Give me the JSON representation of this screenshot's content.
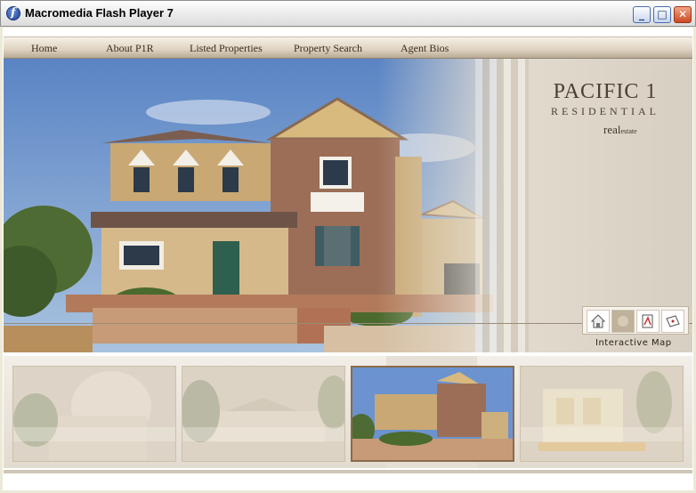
{
  "window": {
    "title": "Macromedia Flash Player 7",
    "icon": "flash-player-icon",
    "controls": {
      "minimize": "minimize-icon",
      "maximize": "maximize-icon",
      "close": "close-icon"
    }
  },
  "nav": {
    "items": [
      {
        "label": "Home"
      },
      {
        "label": "About P1R"
      },
      {
        "label": "Listed Properties"
      },
      {
        "label": "Property Search"
      },
      {
        "label": "Agent Bios"
      }
    ]
  },
  "brand": {
    "title": "PACIFIC 1",
    "subtitle": "RESIDENTIAL",
    "tagline_main": "real",
    "tagline_small": "estate"
  },
  "tools": {
    "icons": [
      "home-icon",
      "photo-icon",
      "pdf-icon",
      "map-icon"
    ],
    "label": "Interactive Map"
  },
  "thumbnails": [
    {
      "name": "thumb-1",
      "state": "faded"
    },
    {
      "name": "thumb-2",
      "state": "faded"
    },
    {
      "name": "thumb-3",
      "state": "selected"
    },
    {
      "name": "thumb-4",
      "state": "faded"
    }
  ],
  "colors": {
    "accent_brown": "#8a6b4a",
    "nav_text": "#3a2c1e",
    "brand_text": "#4a3f33"
  }
}
